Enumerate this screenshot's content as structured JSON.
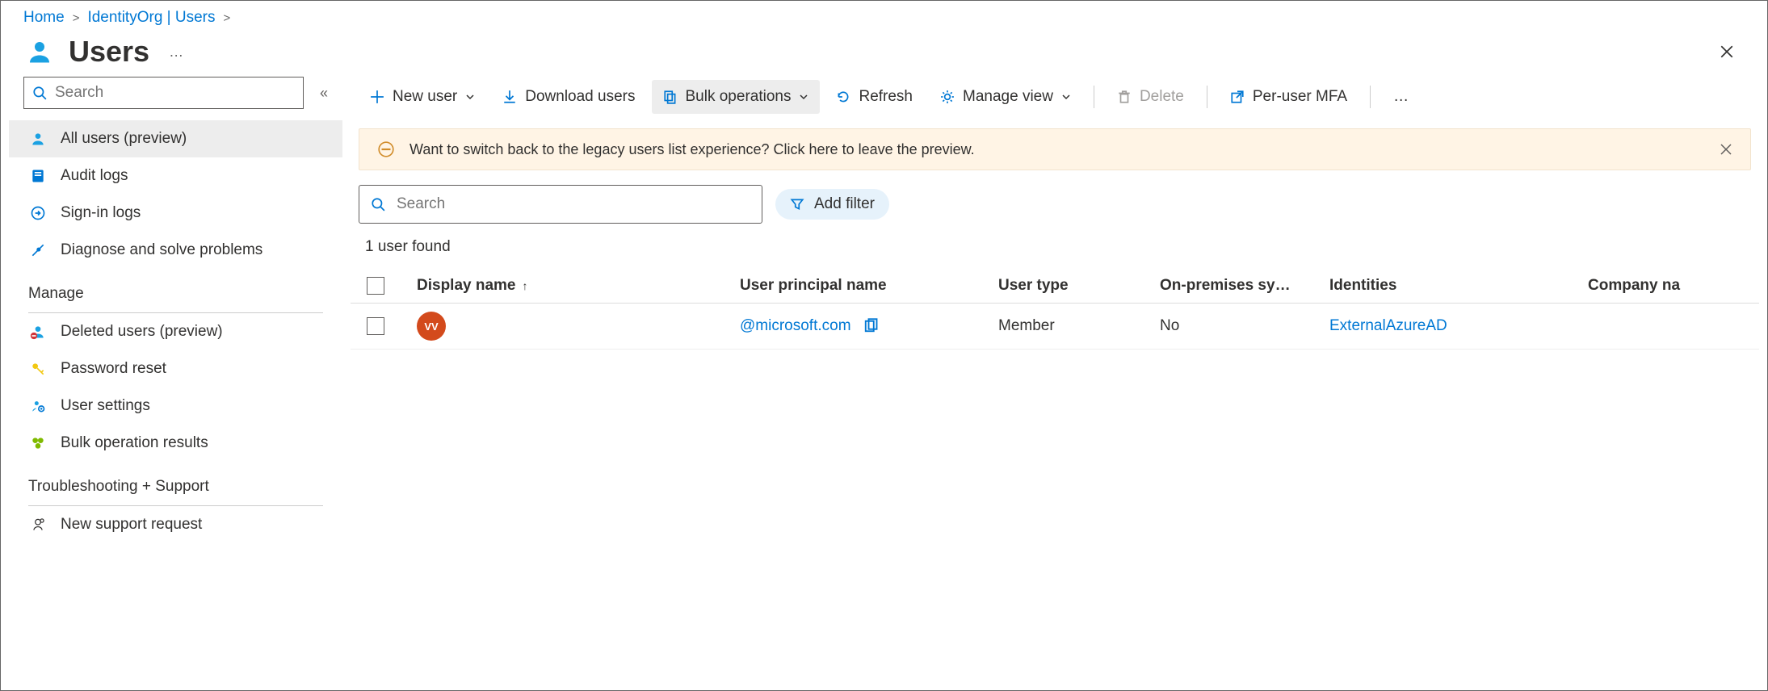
{
  "breadcrumb": [
    {
      "label": "Home"
    },
    {
      "label": "IdentityOrg | Users"
    }
  ],
  "page": {
    "title": "Users"
  },
  "sidebar": {
    "search_placeholder": "Search",
    "items_top": [
      {
        "label": "All users (preview)",
        "icon": "user-icon",
        "active": true
      },
      {
        "label": "Audit logs",
        "icon": "book-icon"
      },
      {
        "label": "Sign-in logs",
        "icon": "arrow-circle-icon"
      },
      {
        "label": "Diagnose and solve problems",
        "icon": "tools-icon"
      }
    ],
    "section_manage": "Manage",
    "items_manage": [
      {
        "label": "Deleted users (preview)",
        "icon": "deleted-user-icon"
      },
      {
        "label": "Password reset",
        "icon": "key-icon"
      },
      {
        "label": "User settings",
        "icon": "user-gear-icon"
      },
      {
        "label": "Bulk operation results",
        "icon": "bulk-icon"
      }
    ],
    "section_trouble": "Troubleshooting + Support",
    "items_trouble": [
      {
        "label": "New support request",
        "icon": "support-icon"
      }
    ]
  },
  "toolbar": {
    "new_user": "New user",
    "download_users": "Download users",
    "bulk_ops": "Bulk operations",
    "refresh": "Refresh",
    "manage_view": "Manage view",
    "delete": "Delete",
    "per_user_mfa": "Per-user MFA"
  },
  "banner": {
    "text": "Want to switch back to the legacy users list experience? Click here to leave the preview."
  },
  "main": {
    "search_placeholder": "Search",
    "add_filter": "Add filter",
    "count_label": "1 user found"
  },
  "columns": {
    "display_name": "Display name",
    "upn": "User principal name",
    "user_type": "User type",
    "on_prem": "On-premises sy…",
    "identities": "Identities",
    "company": "Company na"
  },
  "rows": [
    {
      "avatar_initials": "VV",
      "display_name": "",
      "upn": "@microsoft.com",
      "user_type": "Member",
      "on_prem": "No",
      "identities": "ExternalAzureAD"
    }
  ]
}
